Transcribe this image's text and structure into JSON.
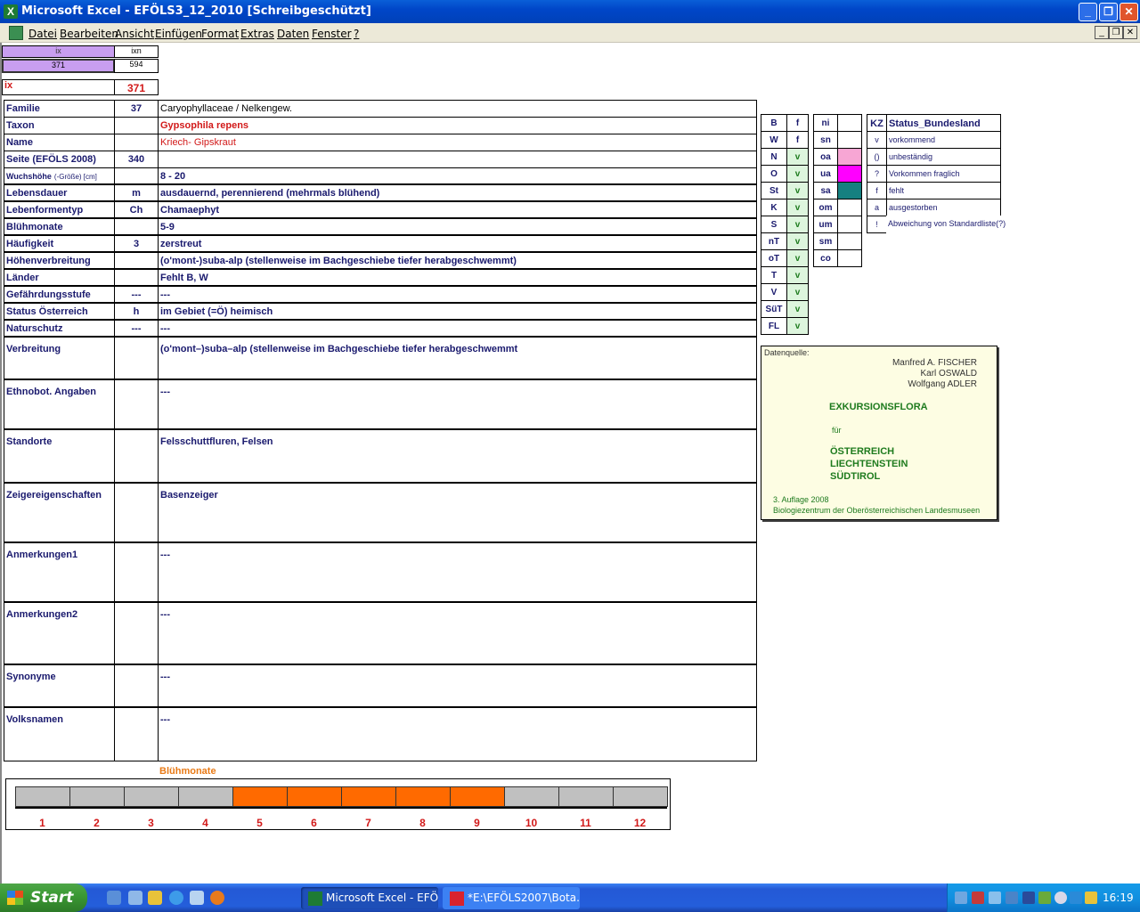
{
  "window": {
    "title": "Microsoft Excel - EFÖLS3_12_2010  [Schreibgeschützt]",
    "min": "_",
    "restore": "❐",
    "close": "✕"
  },
  "menu": [
    "Datei",
    "Bearbeiten",
    "Ansicht",
    "Einfügen",
    "Format",
    "Extras",
    "Daten",
    "Fenster",
    "?"
  ],
  "mdi": {
    "min": "_",
    "restore": "❐",
    "close": "✕"
  },
  "top": {
    "ix_head": "ix",
    "ixn_head": "ixn",
    "ix_val": "371",
    "ixn_val": "594",
    "ix_label": "ix",
    "ix_big": "371"
  },
  "rows": [
    {
      "label": "Familie",
      "code": "37",
      "value": "Caryophyllaceae  /  Nelkengew."
    },
    {
      "label": "Taxon",
      "code": "",
      "value": "Gypsophila repens"
    },
    {
      "label": "Name",
      "code": "",
      "value": "Kriech- Gipskraut"
    },
    {
      "label": "Seite (EFÖLS 2008)",
      "code": "340",
      "value": ""
    },
    {
      "label": "Wuchshöhe",
      "label_suffix": "(-Größe) [cm]",
      "code": "",
      "value": "8 - 20"
    },
    {
      "label": "Lebensdauer",
      "code": "m",
      "value": "ausdauernd, perennierend (mehrmals blühend)"
    },
    {
      "label": "Lebenformentyp",
      "code": "Ch",
      "value": "Chamaephyt"
    },
    {
      "label": "Blühmonate",
      "code": "",
      "value": "5-9"
    },
    {
      "label": "Häufigkeit",
      "code": "3",
      "value": "zerstreut"
    },
    {
      "label": "Höhenverbreitung",
      "code": "",
      "value": "(o'mont-)suba-alp (stellenweise im Bachgeschiebe tiefer herabgeschwemmt)"
    },
    {
      "label": "Länder",
      "code": "",
      "value": "Fehlt B, W"
    },
    {
      "label": "Gefährdungsstufe",
      "code": "---",
      "value": "---"
    },
    {
      "label": "Status Österreich",
      "code": "h",
      "value": "im Gebiet (=Ö) heimisch"
    },
    {
      "label": "Naturschutz",
      "code": "---",
      "value": "---"
    },
    {
      "label": "Verbreitung",
      "code": "",
      "value": "(o'mont–)suba–alp (stellenweise im Bachgeschiebe tiefer herabgeschwemmt"
    },
    {
      "label": "Ethnobot. Angaben",
      "code": "",
      "value": "---"
    },
    {
      "label": "Standorte",
      "code": "",
      "value": "Felsschuttfluren, Felsen"
    },
    {
      "label": "Zeigereigenschaften",
      "code": "",
      "value": "Basenzeiger"
    },
    {
      "label": "Anmerkungen1",
      "code": "",
      "value": "---"
    },
    {
      "label": "Anmerkungen2",
      "code": "",
      "value": "---"
    },
    {
      "label": "Synonyme",
      "code": "",
      "value": "---"
    },
    {
      "label": "Volksnamen",
      "code": "",
      "value": "---"
    }
  ],
  "laender": [
    {
      "k": "B",
      "v": "f"
    },
    {
      "k": "W",
      "v": "f"
    },
    {
      "k": "N",
      "v": "v"
    },
    {
      "k": "O",
      "v": "v"
    },
    {
      "k": "St",
      "v": "v"
    },
    {
      "k": "K",
      "v": "v"
    },
    {
      "k": "S",
      "v": "v"
    },
    {
      "k": "nT",
      "v": "v"
    },
    {
      "k": "oT",
      "v": "v"
    },
    {
      "k": "T",
      "v": "v"
    },
    {
      "k": "V",
      "v": "v"
    },
    {
      "k": "SüT",
      "v": "v"
    },
    {
      "k": "FL",
      "v": "v"
    }
  ],
  "hoehen": [
    {
      "k": "ni",
      "color": ""
    },
    {
      "k": "sn",
      "color": ""
    },
    {
      "k": "oa",
      "color": "#f7a6d4"
    },
    {
      "k": "ua",
      "color": "#ff00ff"
    },
    {
      "k": "sa",
      "color": "#168080"
    },
    {
      "k": "om",
      "color": ""
    },
    {
      "k": "um",
      "color": ""
    },
    {
      "k": "sm",
      "color": ""
    },
    {
      "k": "co",
      "color": ""
    }
  ],
  "status": {
    "kz_head": "KZ",
    "status_head": "Status_Bundesland",
    "items": [
      {
        "kz": "v",
        "text": "vorkommend"
      },
      {
        "kz": "()",
        "text": "unbeständig"
      },
      {
        "kz": "?",
        "text": "Vorkommen fraglich"
      },
      {
        "kz": "f",
        "text": "fehlt"
      },
      {
        "kz": "a",
        "text": "ausgestorben"
      },
      {
        "kz": "!",
        "text": "Abweichung von Standardliste(?)"
      }
    ]
  },
  "source": {
    "label": "Datenquelle:",
    "authors": [
      "Manfred A. FISCHER",
      "Karl OSWALD",
      "Wolfgang ADLER"
    ],
    "title": "EXKURSIONSFLORA",
    "fuer": "für",
    "regions": [
      "ÖSTERREICH",
      "LIECHTENSTEIN",
      "SÜDTIROL"
    ],
    "edition": "3. Auflage 2008",
    "publisher": "Biologiezentrum der Oberösterreichischen Landesmuseen"
  },
  "bloom": {
    "title": "Blühmonate",
    "months": [
      "1",
      "2",
      "3",
      "4",
      "5",
      "6",
      "7",
      "8",
      "9",
      "10",
      "11",
      "12"
    ],
    "active": [
      5,
      6,
      7,
      8,
      9
    ]
  },
  "taskbar": {
    "start": "Start",
    "buttons": [
      "Microsoft Excel - EFÖ...",
      "*E:\\EFÖLS2007\\Bota..."
    ],
    "clock": "16:19"
  },
  "colors": {
    "title_blue": "#0046c8",
    "bloom_on": "#ff6a00",
    "bloom_off": "#c0c0c0",
    "accent_red": "#d21a1a",
    "laender_green": "#ddf5dd",
    "source_green": "#1e7b1e"
  }
}
